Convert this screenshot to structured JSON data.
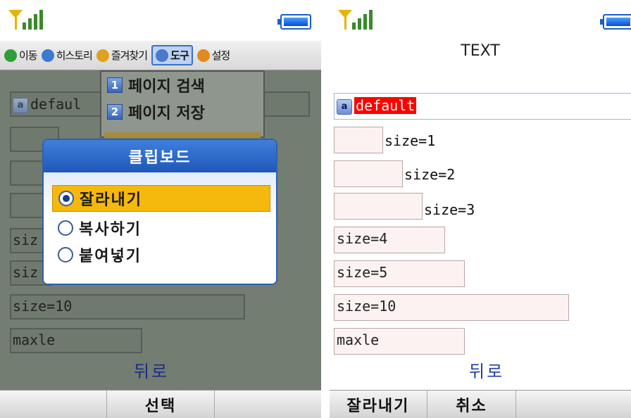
{
  "left_screen": {
    "menubar": {
      "items": [
        {
          "label": "이동",
          "color": "#2f9e3a"
        },
        {
          "label": "히스토리",
          "color": "#3a7ad0"
        },
        {
          "label": "즐겨찾기",
          "color": "#e0a020"
        },
        {
          "label": "도구",
          "color": "#4a7ac8"
        },
        {
          "label": "설정",
          "color": "#e08a20"
        }
      ],
      "active_index": 3
    },
    "dropdown": {
      "items": [
        {
          "num": "1",
          "label": "페이지 검색"
        },
        {
          "num": "2",
          "label": "페이지 저장"
        }
      ]
    },
    "fields": {
      "text_value": "defaul",
      "size_a": "siz",
      "size_b": "siz",
      "size10": "size=10",
      "maxle": "maxle"
    },
    "dialog": {
      "title": "클립보드",
      "options": [
        {
          "label": "잘라내기",
          "selected": true
        },
        {
          "label": "복사하기",
          "selected": false
        },
        {
          "label": "붙여넣기",
          "selected": false
        }
      ]
    },
    "back_label": "뒤로",
    "softkeys": {
      "left": "",
      "center": "선택",
      "right": ""
    }
  },
  "right_screen": {
    "page_title": "TEXT",
    "text_field": {
      "badge": "a",
      "value": "default"
    },
    "fields": [
      {
        "value": "",
        "label": "size=1"
      },
      {
        "value": "",
        "label": "size=2"
      },
      {
        "value": "",
        "label": "size=3"
      },
      {
        "value": "size=4"
      },
      {
        "value": "size=5"
      },
      {
        "value": "size=10"
      },
      {
        "value": "maxle"
      }
    ],
    "back_label": "뒤로",
    "softkeys": {
      "left": "잘라내기",
      "center": "취소",
      "right": ""
    }
  },
  "colors": {
    "accent": "#f5b80c",
    "dialog_title": "#2f6ccc",
    "link": "#1e3ea8",
    "highlight": "#ff0000"
  },
  "icons": [
    "signal-icon",
    "battery-icon",
    "radio-icon",
    "input-mode-icon"
  ]
}
